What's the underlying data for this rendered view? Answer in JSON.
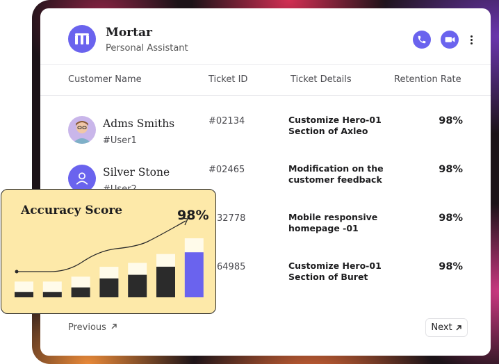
{
  "app": {
    "title": "Mortar",
    "subtitle": "Personal Assistant"
  },
  "header_actions": {
    "call_icon": "phone-icon",
    "video_icon": "video-camera-icon",
    "menu_icon": "more-vertical-icon"
  },
  "columns": [
    "Customer Name",
    "Ticket ID",
    "Ticket Details",
    "Retention Rate"
  ],
  "rows": [
    {
      "name": "Adms Smiths",
      "user": "#User1",
      "ticket": "#02134",
      "details_line1": "Customize Hero-01",
      "details_line2": "Section of Axleo",
      "rate": "98%"
    },
    {
      "name": "Silver Stone",
      "user": "#User2",
      "ticket": "#02465",
      "details_line1": "Modification on the",
      "details_line2": "customer feedback",
      "rate": "98%"
    },
    {
      "name": "",
      "user": "",
      "ticket": "32778",
      "details_line1": "Mobile responsive",
      "details_line2": "homepage -01",
      "rate": "98%"
    },
    {
      "name": "",
      "user": "",
      "ticket": "64985",
      "details_line1": "Customize Hero-01",
      "details_line2": "Section of Buret",
      "rate": "98%"
    }
  ],
  "pagination": {
    "previous": "Previous",
    "next": "Next"
  },
  "accuracy_card": {
    "title": "Accuracy Score",
    "value": "98%"
  },
  "colors": {
    "accent": "#6a63ee",
    "card_yellow": "#fde9a9",
    "bar_dark": "#2b2b2b"
  },
  "chart_data": {
    "type": "bar",
    "categories": [
      "1",
      "2",
      "3",
      "4",
      "5",
      "6",
      "7"
    ],
    "series": [
      {
        "values": [
          0.12,
          0.12,
          0.22,
          0.42,
          0.5,
          0.68,
          1.0
        ]
      }
    ],
    "trend_line": true
  }
}
